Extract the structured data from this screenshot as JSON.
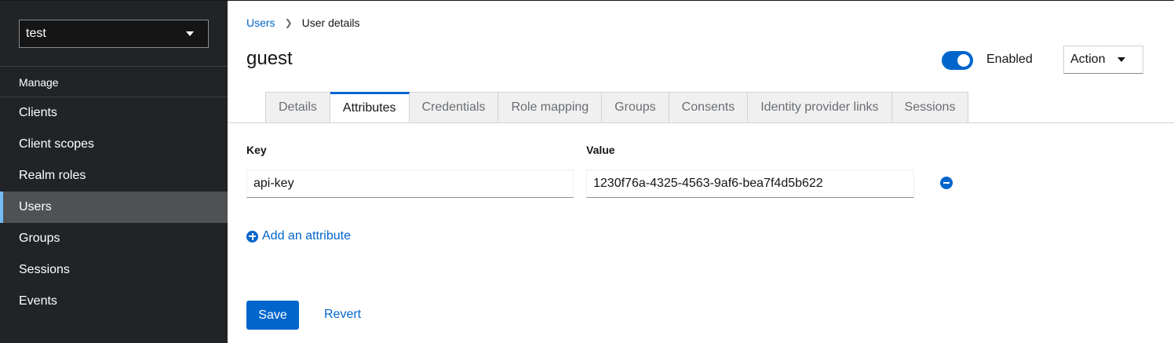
{
  "sidebar": {
    "realm": "test",
    "section_title": "Manage",
    "items": [
      {
        "label": "Clients"
      },
      {
        "label": "Client scopes"
      },
      {
        "label": "Realm roles"
      },
      {
        "label": "Users",
        "active": true
      },
      {
        "label": "Groups"
      },
      {
        "label": "Sessions"
      },
      {
        "label": "Events"
      }
    ]
  },
  "breadcrumb": {
    "parent": "Users",
    "current": "User details"
  },
  "header": {
    "title": "guest",
    "enabled_label": "Enabled",
    "enabled": true,
    "action_label": "Action"
  },
  "tabs": [
    {
      "label": "Details"
    },
    {
      "label": "Attributes",
      "active": true
    },
    {
      "label": "Credentials"
    },
    {
      "label": "Role mapping"
    },
    {
      "label": "Groups"
    },
    {
      "label": "Consents"
    },
    {
      "label": "Identity provider links"
    },
    {
      "label": "Sessions"
    }
  ],
  "attributes": {
    "key_label": "Key",
    "value_label": "Value",
    "rows": [
      {
        "key": "api-key",
        "value": "1230f76a-4325-4563-9af6-bea7f4d5b622"
      }
    ],
    "add_label": "Add an attribute"
  },
  "footer": {
    "save_label": "Save",
    "revert_label": "Revert"
  },
  "colors": {
    "accent": "#0066cc",
    "sidebar_bg": "#212427",
    "sidebar_active": "#4f5255"
  }
}
